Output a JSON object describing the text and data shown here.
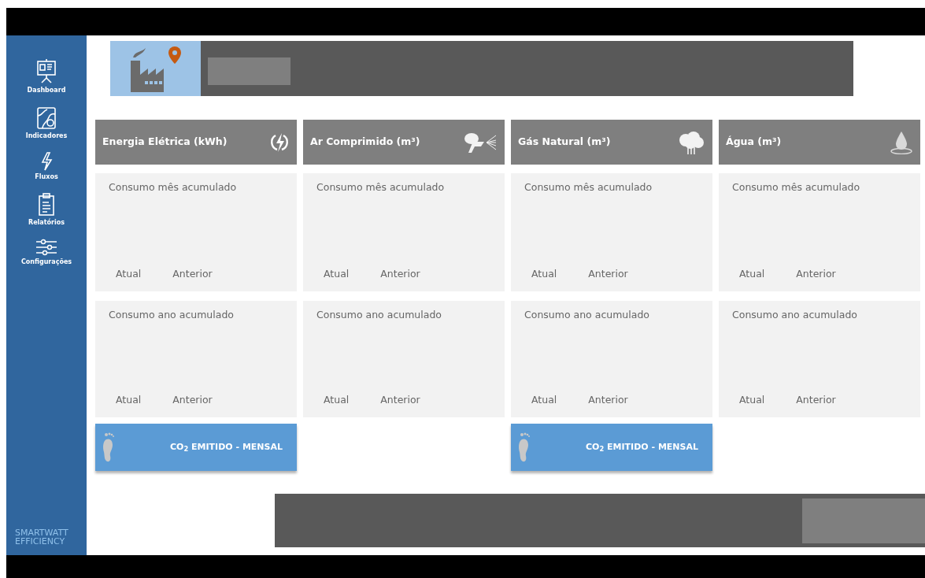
{
  "sidebar": {
    "items": [
      {
        "kind": "dashboard",
        "label": "Dashboard"
      },
      {
        "kind": "map",
        "label": "Indicadores"
      },
      {
        "kind": "bolt",
        "label": "Fluxos"
      },
      {
        "kind": "clipboard",
        "label": "Relatórios"
      },
      {
        "kind": "sliders",
        "label": "Configurações"
      }
    ],
    "brand": [
      "SMARTWATT",
      "EFFICIENCY"
    ]
  },
  "columns": [
    {
      "kind": "electricity",
      "title": "Energia Elétrica (kWh)",
      "month": {
        "title": "Consumo mês acumulado",
        "current": "Atual",
        "previous": "Anterior"
      },
      "year": {
        "title": "Consumo ano acumulado",
        "current": "Atual",
        "previous": "Anterior"
      },
      "co2": "CO$_{2}$ EMITIDO  - MENSAL"
    },
    {
      "kind": "air",
      "title": "Ar Comprimido (m³)",
      "month": {
        "title": "Consumo mês acumulado",
        "current": "Atual",
        "previous": "Anterior"
      },
      "year": {
        "title": "Consumo ano acumulado",
        "current": "Atual",
        "previous": "Anterior"
      }
    },
    {
      "kind": "gas",
      "title": "Gás Natural (m³)",
      "month": {
        "title": "Consumo mês acumulado",
        "current": "Atual",
        "previous": "Anterior"
      },
      "year": {
        "title": "Consumo ano acumulado",
        "current": "Atual",
        "previous": "Anterior"
      },
      "co2": "CO$_{2}$ EMITIDO  - MENSAL"
    },
    {
      "kind": "water",
      "title": "Água (m³)",
      "month": {
        "title": "Consumo mês acumulado",
        "current": "Atual",
        "previous": "Anterior"
      },
      "year": {
        "title": "Consumo ano acumulado",
        "current": "Atual",
        "previous": "Anterior"
      }
    }
  ]
}
